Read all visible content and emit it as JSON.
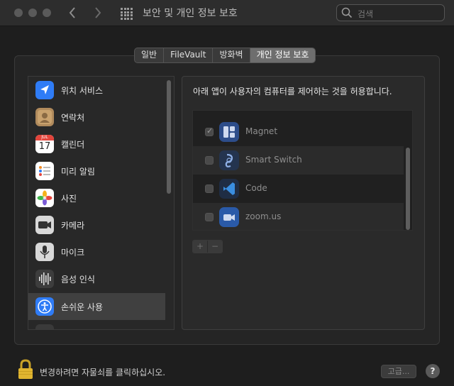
{
  "window": {
    "title": "보안 및 개인 정보 보호",
    "search_placeholder": "검색"
  },
  "tabs": [
    {
      "label": "일반",
      "selected": false
    },
    {
      "label": "FileVault",
      "selected": false
    },
    {
      "label": "방화벽",
      "selected": false
    },
    {
      "label": "개인 정보 보호",
      "selected": true
    }
  ],
  "sidebar": {
    "items": [
      {
        "label": "위치 서비스",
        "icon": "location-arrow-icon"
      },
      {
        "label": "연락처",
        "icon": "contacts-icon"
      },
      {
        "label": "캘린더",
        "icon": "calendar-icon",
        "month": "JUL",
        "day": "17"
      },
      {
        "label": "미리 알림",
        "icon": "reminders-icon"
      },
      {
        "label": "사진",
        "icon": "photos-icon"
      },
      {
        "label": "카메라",
        "icon": "camera-icon"
      },
      {
        "label": "마이크",
        "icon": "microphone-icon"
      },
      {
        "label": "음성 인식",
        "icon": "speech-recognition-icon"
      },
      {
        "label": "손쉬운 사용",
        "icon": "accessibility-icon",
        "selected": true
      }
    ]
  },
  "main": {
    "description": "아래 앱이 사용자의 컴퓨터를 제어하는 것을 허용합니다.",
    "apps": [
      {
        "name": "Magnet",
        "checked": true,
        "icon": "magnet-app-icon"
      },
      {
        "name": "Smart Switch",
        "checked": false,
        "icon": "smart-switch-app-icon"
      },
      {
        "name": "Code",
        "checked": false,
        "icon": "vscode-app-icon"
      },
      {
        "name": "zoom.us",
        "checked": false,
        "icon": "zoom-app-icon"
      }
    ],
    "add_label": "+",
    "remove_label": "−"
  },
  "footer": {
    "lock_text": "변경하려면 자물쇠를 클릭하십시오.",
    "advanced_label": "고급...",
    "help_label": "?"
  },
  "colors": {
    "accent": "#2f6fd6",
    "window_bg": "#1e1e1e",
    "selected_row": "#404040"
  }
}
